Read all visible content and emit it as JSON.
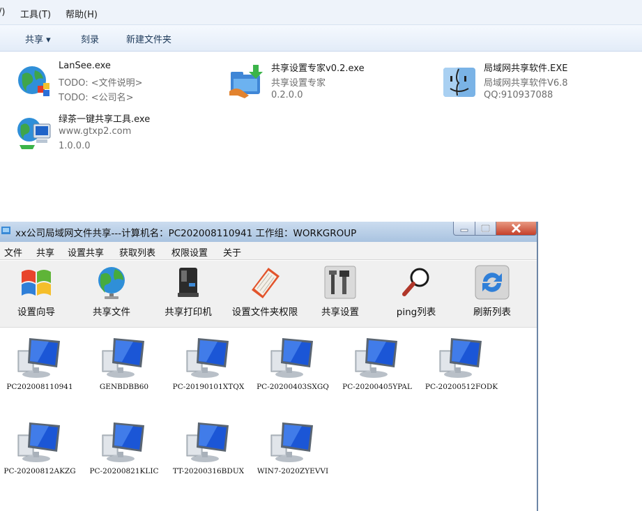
{
  "explorer": {
    "menu": [
      "/)",
      "工具(T)",
      "帮助(H)"
    ],
    "toolbar": {
      "share": "共享 ▾",
      "burn": "刻录",
      "new_folder": "新建文件夹"
    },
    "files": [
      {
        "name": "LanSee.exe",
        "desc": "TODO: <文件说明>",
        "company": "TODO: <公司名>",
        "icon": "globe-app-icon"
      },
      {
        "name": "共享设置专家v0.2.exe",
        "desc": "共享设置专家",
        "company": "0.2.0.0",
        "icon": "share-folder-icon"
      },
      {
        "name": "局域网共享软件.EXE",
        "desc": "局域网共享软件V6.8",
        "company": "QQ:910937088",
        "icon": "finder-face-icon"
      },
      {
        "name": "绿茶一键共享工具.exe",
        "desc": "www.gtxp2.com",
        "company": "1.0.0.0",
        "icon": "network-globe-icon"
      }
    ]
  },
  "app": {
    "title": "xx公司局域网文件共享---计算机名：PC202008110941  工作组：WORKGROUP",
    "menu": [
      "文件",
      "共享",
      "设置共享",
      "获取列表",
      "权限设置",
      "关于"
    ],
    "tools": [
      {
        "label": "设置向导",
        "icon": "windows-logo-icon"
      },
      {
        "label": "共享文件",
        "icon": "globe-icon"
      },
      {
        "label": "共享打印机",
        "icon": "printer-icon"
      },
      {
        "label": "设置文件夹权限",
        "icon": "notebook-icon"
      },
      {
        "label": "共享设置",
        "icon": "tools-icon"
      },
      {
        "label": "ping列表",
        "icon": "magnifier-icon"
      },
      {
        "label": "刷新列表",
        "icon": "refresh-icon"
      }
    ],
    "computers": [
      "PC202008110941",
      "GENBDBB60",
      "PC-20190101XTQX",
      "PC-20200403SXGQ",
      "PC-20200405YPAL",
      "PC-20200512FODK",
      "PC-20200812AKZG",
      "PC-20200821KLIC",
      "TT-20200316BDUX",
      "WIN7-2020ZYEVVI"
    ]
  }
}
